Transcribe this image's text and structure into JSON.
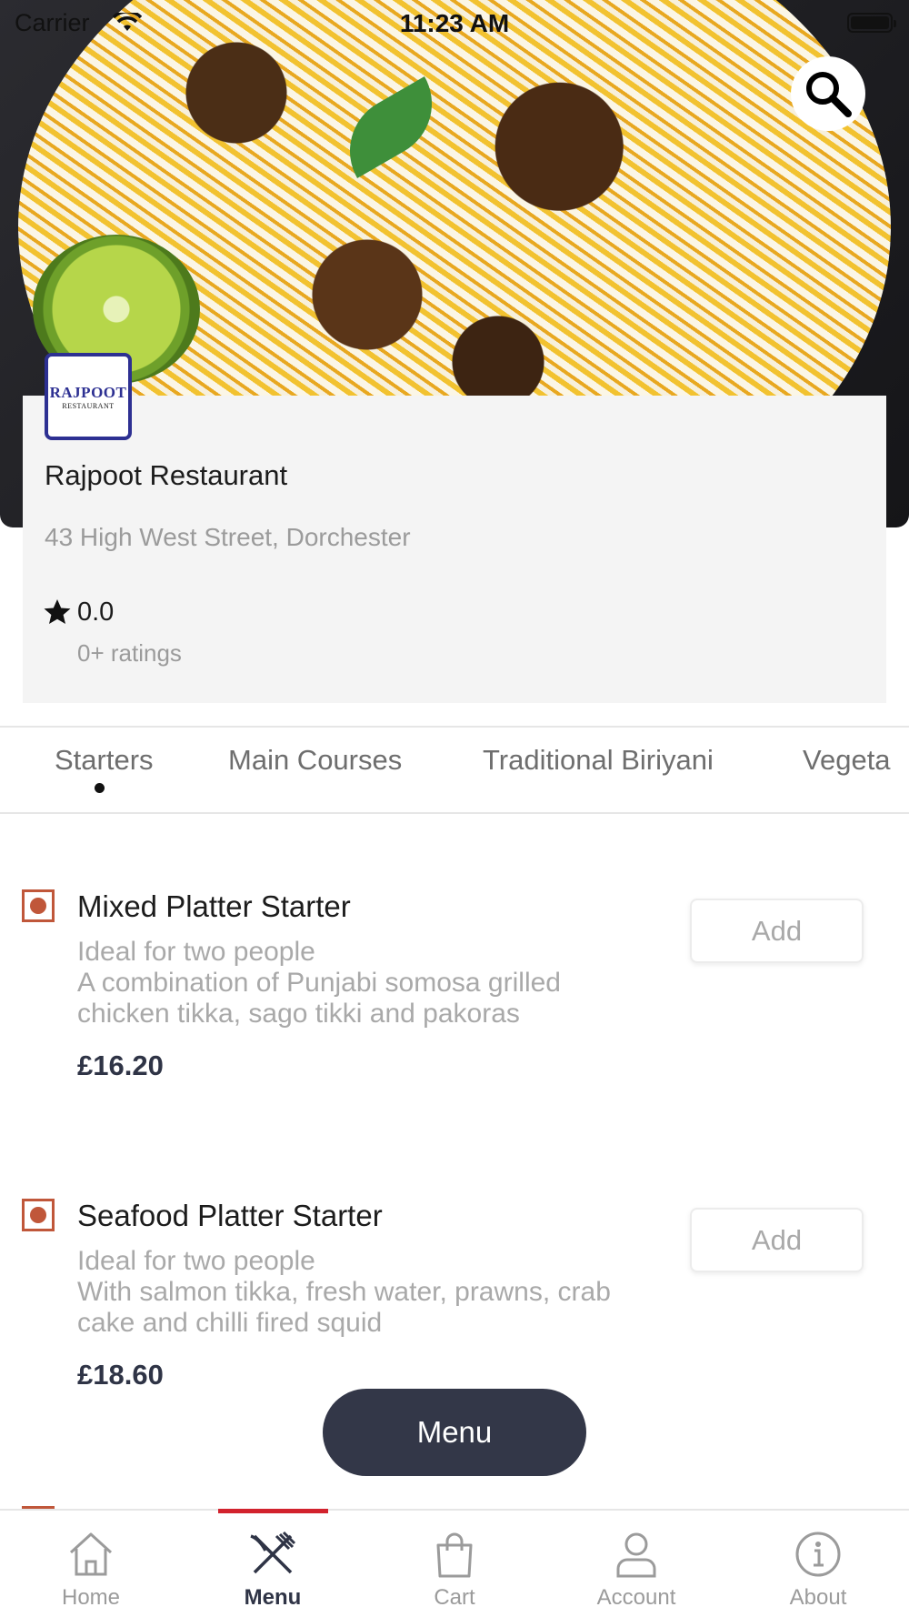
{
  "status_bar": {
    "carrier": "Carrier",
    "time": "11:23 AM"
  },
  "restaurant": {
    "logo_text": "RAJPOOT",
    "logo_subtext": "RESTAURANT",
    "name": "Rajpoot Restaurant",
    "address": "43 High West Street, Dorchester",
    "rating": "0.0",
    "ratings_count": "0+ ratings"
  },
  "tabs": [
    {
      "label": "Starters",
      "selected": true
    },
    {
      "label": "Main Courses",
      "selected": false
    },
    {
      "label": "Traditional Biriyani",
      "selected": false
    },
    {
      "label": "Vegeta",
      "selected": false
    }
  ],
  "items": [
    {
      "name": "Mixed Platter Starter",
      "description": "Ideal for two people\nA combination of Punjabi somosa grilled chicken tikka, sago tikki and pakoras",
      "price": "£16.20",
      "add_label": "Add"
    },
    {
      "name": "Seafood Platter Starter",
      "description": "Ideal for two people\nWith salmon tikka, fresh water, prawns, crab cake and chilli fired squid",
      "price": "£18.60",
      "add_label": "Add"
    }
  ],
  "menu_button": "Menu",
  "bottom_nav": [
    {
      "label": "Home",
      "icon": "home-icon",
      "active": false
    },
    {
      "label": "Menu",
      "icon": "fork-knife-icon",
      "active": true
    },
    {
      "label": "Cart",
      "icon": "shopping-bag-icon",
      "active": false
    },
    {
      "label": "Account",
      "icon": "user-icon",
      "active": false
    },
    {
      "label": "About",
      "icon": "info-icon",
      "active": false
    }
  ],
  "colors": {
    "accent_red": "#d2222d",
    "veg_mark": "#c0573a",
    "fab_bg": "#333748",
    "logo_blue": "#2d3092"
  }
}
